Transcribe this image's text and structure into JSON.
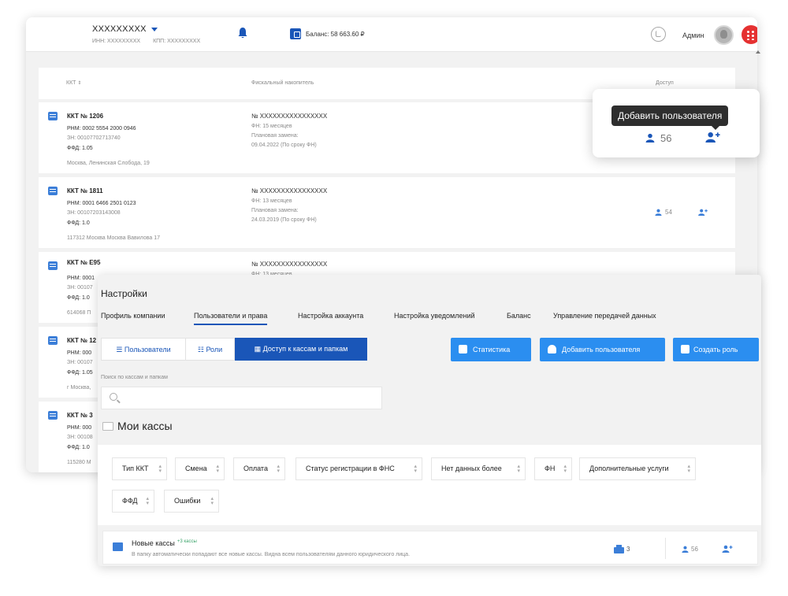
{
  "header": {
    "org_name": "XXXXXXXXX",
    "inn": "ИНН: XXXXXXXXX",
    "kpp": "КПП: XXXXXXXXX",
    "balance": "Баланс: 58 663.60 ₽",
    "admin": "Админ"
  },
  "grid": {
    "col_kkt": "ККТ",
    "col_fn": "Фискальный накопитель",
    "col_access": "Доступ"
  },
  "rows": [
    {
      "name": "ККТ № 1206",
      "rnm": "РНМ: 0002 5554 2000 0946",
      "zn": "ЗН: 00107702713740",
      "ffd": "ФФД: 1.05",
      "address": "Москва, Ленинская Слобода, 19",
      "fn_num": "№ XXXXXXXXXXXXXXXX",
      "fn_term": "ФН: 15 месяцев",
      "fn_repl": "Плановая замена:",
      "fn_date": "09.04.2022 (По сроку ФН)"
    },
    {
      "name": "ККТ № 1811",
      "rnm": "РНМ: 0001 6466 2501 0123",
      "zn": "ЗН: 00107203143008",
      "ffd": "ФФД: 1.0",
      "address": "117312 Москва Москва Вавилова 17",
      "fn_num": "№ XXXXXXXXXXXXXXXX",
      "fn_term": "ФН: 13 месяцев",
      "fn_repl": "Плановая замена:",
      "fn_date": "24.03.2019 (По сроку ФН)",
      "users": "54"
    },
    {
      "name": "ККТ № E95",
      "rnm": "РНМ: 0001",
      "zn": "ЗН: 00107",
      "ffd": "ФФД: 1.0",
      "address": "614068 П",
      "fn_num": "№ XXXXXXXXXXXXXXXX",
      "fn_term": "ФН: 13 месяцев"
    },
    {
      "name": "ККТ № 12",
      "rnm": "РНМ: 000",
      "zn": "ЗН: 00107",
      "ffd": "ФФД: 1.05",
      "address": "г Москва,"
    },
    {
      "name": "ККТ № 3",
      "rnm": "РНМ: 000",
      "zn": "ЗН: 00108",
      "ffd": "ФФД: 1.0",
      "address": "115280 М"
    }
  ],
  "tooltip": {
    "text": "Добавить пользователя",
    "users": "56"
  },
  "settings": {
    "title": "Настройки",
    "tabs": [
      "Профиль компании",
      "Пользователи и права",
      "Настройка аккаунта",
      "Настройка уведомлений",
      "Баланс",
      "Управление передачей данных"
    ],
    "seg_users": "Пользователи",
    "seg_roles": "Роли",
    "seg_access": "Доступ к кассам и папкам",
    "btn_stats": "Статистика",
    "btn_add_user": "Добавить пользователя",
    "btn_create_role": "Создать роль",
    "search_label": "Поиск по кассам и папкам",
    "my_kassy": "Мои кассы",
    "filters": [
      "Тип ККТ",
      "Смена",
      "Оплата",
      "Статус регистрации в ФНС",
      "Нет данных более",
      "ФН",
      "Дополнительные услуги",
      "ФФД",
      "Ошибки"
    ],
    "folder": {
      "name": "Новые кассы",
      "count": "+3 кассы",
      "desc": "В папку автоматически попадают все новые кассы. Видна всем пользователям данного юридического лица.",
      "kkt": "3",
      "users": "56"
    }
  }
}
